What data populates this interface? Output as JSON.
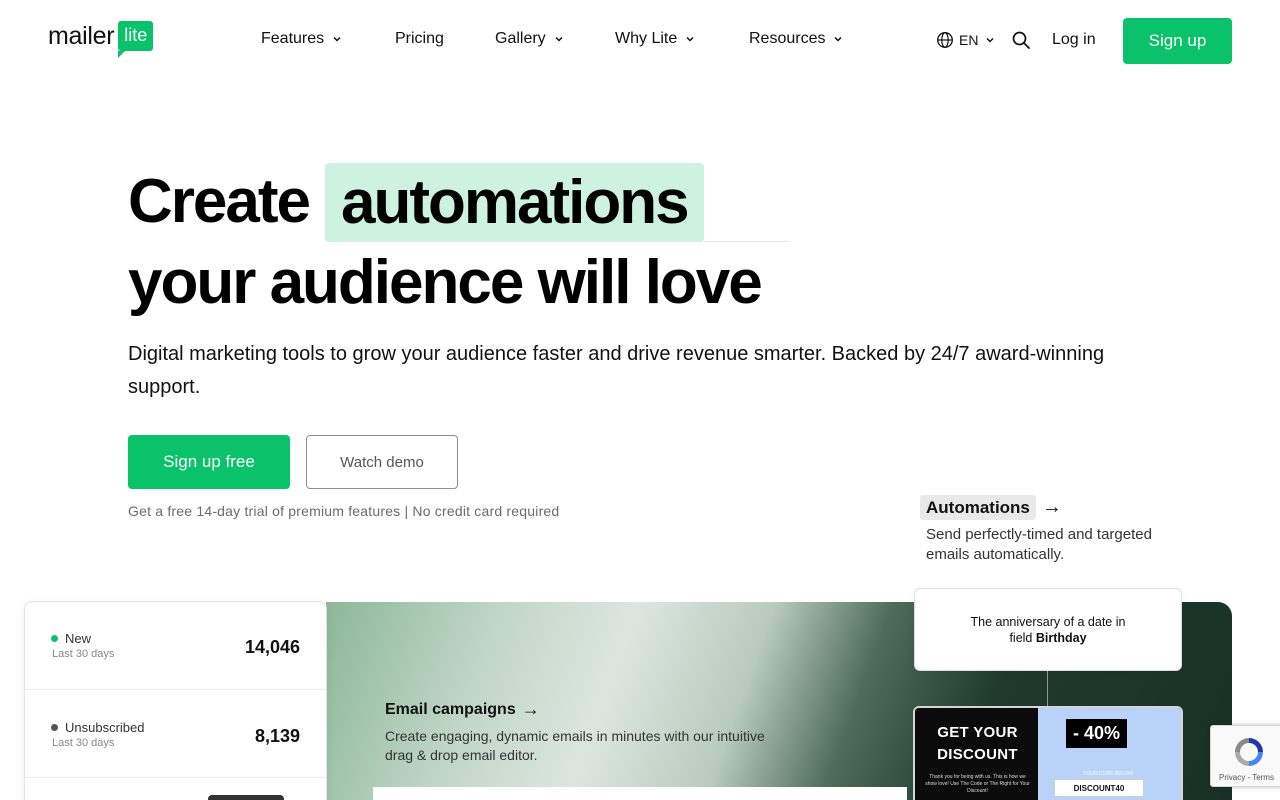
{
  "header": {
    "logo_word": "mailer",
    "logo_badge": "lite",
    "nav": [
      {
        "label": "Features",
        "has_dropdown": true
      },
      {
        "label": "Pricing",
        "has_dropdown": false
      },
      {
        "label": "Gallery",
        "has_dropdown": true
      },
      {
        "label": "Why Lite",
        "has_dropdown": true
      },
      {
        "label": "Resources",
        "has_dropdown": true
      }
    ],
    "language": "EN",
    "login_label": "Log in",
    "signup_label": "Sign up"
  },
  "hero": {
    "title_prefix": "Create",
    "title_highlight": "automations",
    "title_line2": "your audience will love",
    "subtitle": "Digital marketing tools to grow your audience faster and drive revenue smarter. Backed by 24/7 award-winning support.",
    "cta_primary": "Sign up free",
    "cta_secondary": "Watch demo",
    "trial_note": "Get a free 14-day trial of premium features | No credit card required"
  },
  "automations": {
    "title": "Automations",
    "arrow": "→",
    "description": "Send perfectly-timed and targeted emails automatically."
  },
  "email_campaigns": {
    "title": "Email campaigns",
    "arrow": "→",
    "description": "Create engaging, dynamic emails in minutes with our intuitive drag & drop email editor."
  },
  "stats": [
    {
      "label": "New",
      "period": "Last 30 days",
      "value": "14,046",
      "dot_color": "#09c269"
    },
    {
      "label": "Unsubscribed",
      "period": "Last 30 days",
      "value": "8,139",
      "dot_color": "#555555"
    }
  ],
  "trigger": {
    "line1": "The anniversary of a date in",
    "line2_prefix": "field",
    "line2_field": "Birthday"
  },
  "promo": {
    "headline_1": "GET YOUR",
    "headline_2": "DISCOUNT",
    "small_text": "Thank you for being with us. This is how we show love! Use The Code or The Right for Your Discount!",
    "discount": "- 40%",
    "code_caption": "YOUR CODE BELOW",
    "code": "DISCOUNT40"
  },
  "recaptcha": {
    "links": "Privacy - Terms"
  },
  "colors": {
    "brand_green": "#09c269",
    "highlight": "#cdf2df"
  }
}
